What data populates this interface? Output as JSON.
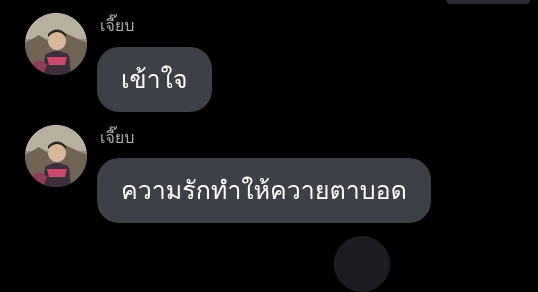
{
  "conversation": {
    "messages": [
      {
        "sender": "เจี๊ยบ",
        "text": "เข้าใจ",
        "avatar_icon": "user-avatar-photo"
      },
      {
        "sender": "เจี๊ยบ",
        "text": "ความรักทำให้ควายตาบอด",
        "avatar_icon": "user-avatar-photo"
      }
    ]
  },
  "colors": {
    "background": "#000000",
    "bubble": "#3e4047",
    "sender_name": "#a9abb0",
    "message_text": "#ffffff"
  }
}
